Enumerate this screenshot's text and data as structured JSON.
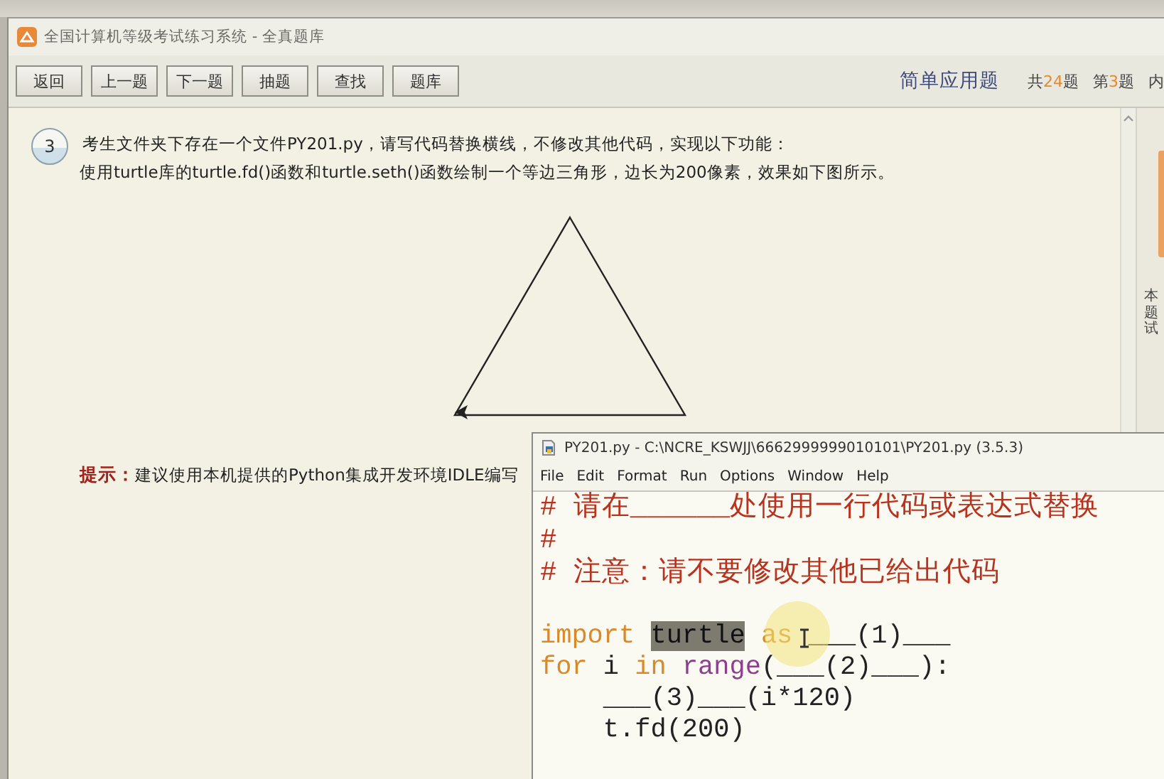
{
  "window": {
    "title": "全国计算机等级考试练习系统 - 全真题库"
  },
  "toolbar": {
    "buttons": [
      "返回",
      "上一题",
      "下一题",
      "抽题",
      "查找",
      "题库"
    ],
    "category": "简单应用题",
    "counters": [
      {
        "prefix": "共",
        "number": "24",
        "suffix": "题"
      },
      {
        "prefix": "第",
        "number": "3",
        "suffix": "题"
      }
    ],
    "trailing": "内"
  },
  "question": {
    "number": "3",
    "lines": [
      "考生文件夹下存在一个文件PY201.py，请写代码替换横线，不修改其他代码，实现以下功能：",
      "使用turtle库的turtle.fd()函数和turtle.seth()函数绘制一个等边三角形，边长为200像素，效果如下图所示。"
    ],
    "hint_label": "提示：",
    "hint": "建议使用本机提供的Python集成开发环境IDLE编写"
  },
  "side_panel": {
    "text": "本题试"
  },
  "editor": {
    "title": "PY201.py - C:\\NCRE_KSWJJ\\6662999999010101\\PY201.py (3.5.3)",
    "menu": [
      "File",
      "Edit",
      "Format",
      "Run",
      "Options",
      "Window",
      "Help"
    ],
    "lines": [
      {
        "tokens": [
          {
            "kind": "comment",
            "text": "# 请在______处使用一行代码或表达式替换"
          }
        ]
      },
      {
        "tokens": [
          {
            "kind": "comment",
            "text": "#"
          }
        ]
      },
      {
        "tokens": [
          {
            "kind": "comment",
            "text": "# 注意：请不要修改其他已给出代码"
          }
        ]
      },
      {
        "kind": "blank"
      },
      {
        "tokens": [
          {
            "kind": "keyword",
            "text": "import "
          },
          {
            "kind": "selected",
            "text": "turtle"
          },
          {
            "kind": "keyword",
            "text": " as"
          },
          {
            "kind": "plain",
            "text": " ___(1)___"
          }
        ]
      },
      {
        "tokens": [
          {
            "kind": "keyword",
            "text": "for"
          },
          {
            "kind": "plain",
            "text": " i "
          },
          {
            "kind": "keyword",
            "text": "in "
          },
          {
            "kind": "builtin",
            "text": "range"
          },
          {
            "kind": "plain",
            "text": "(___(2)___):"
          }
        ]
      },
      {
        "tokens": [
          {
            "kind": "plain",
            "text": "    ___(3)___(i*120)"
          }
        ]
      },
      {
        "tokens": [
          {
            "kind": "plain",
            "text": "    t.fd(200)"
          }
        ]
      }
    ]
  }
}
